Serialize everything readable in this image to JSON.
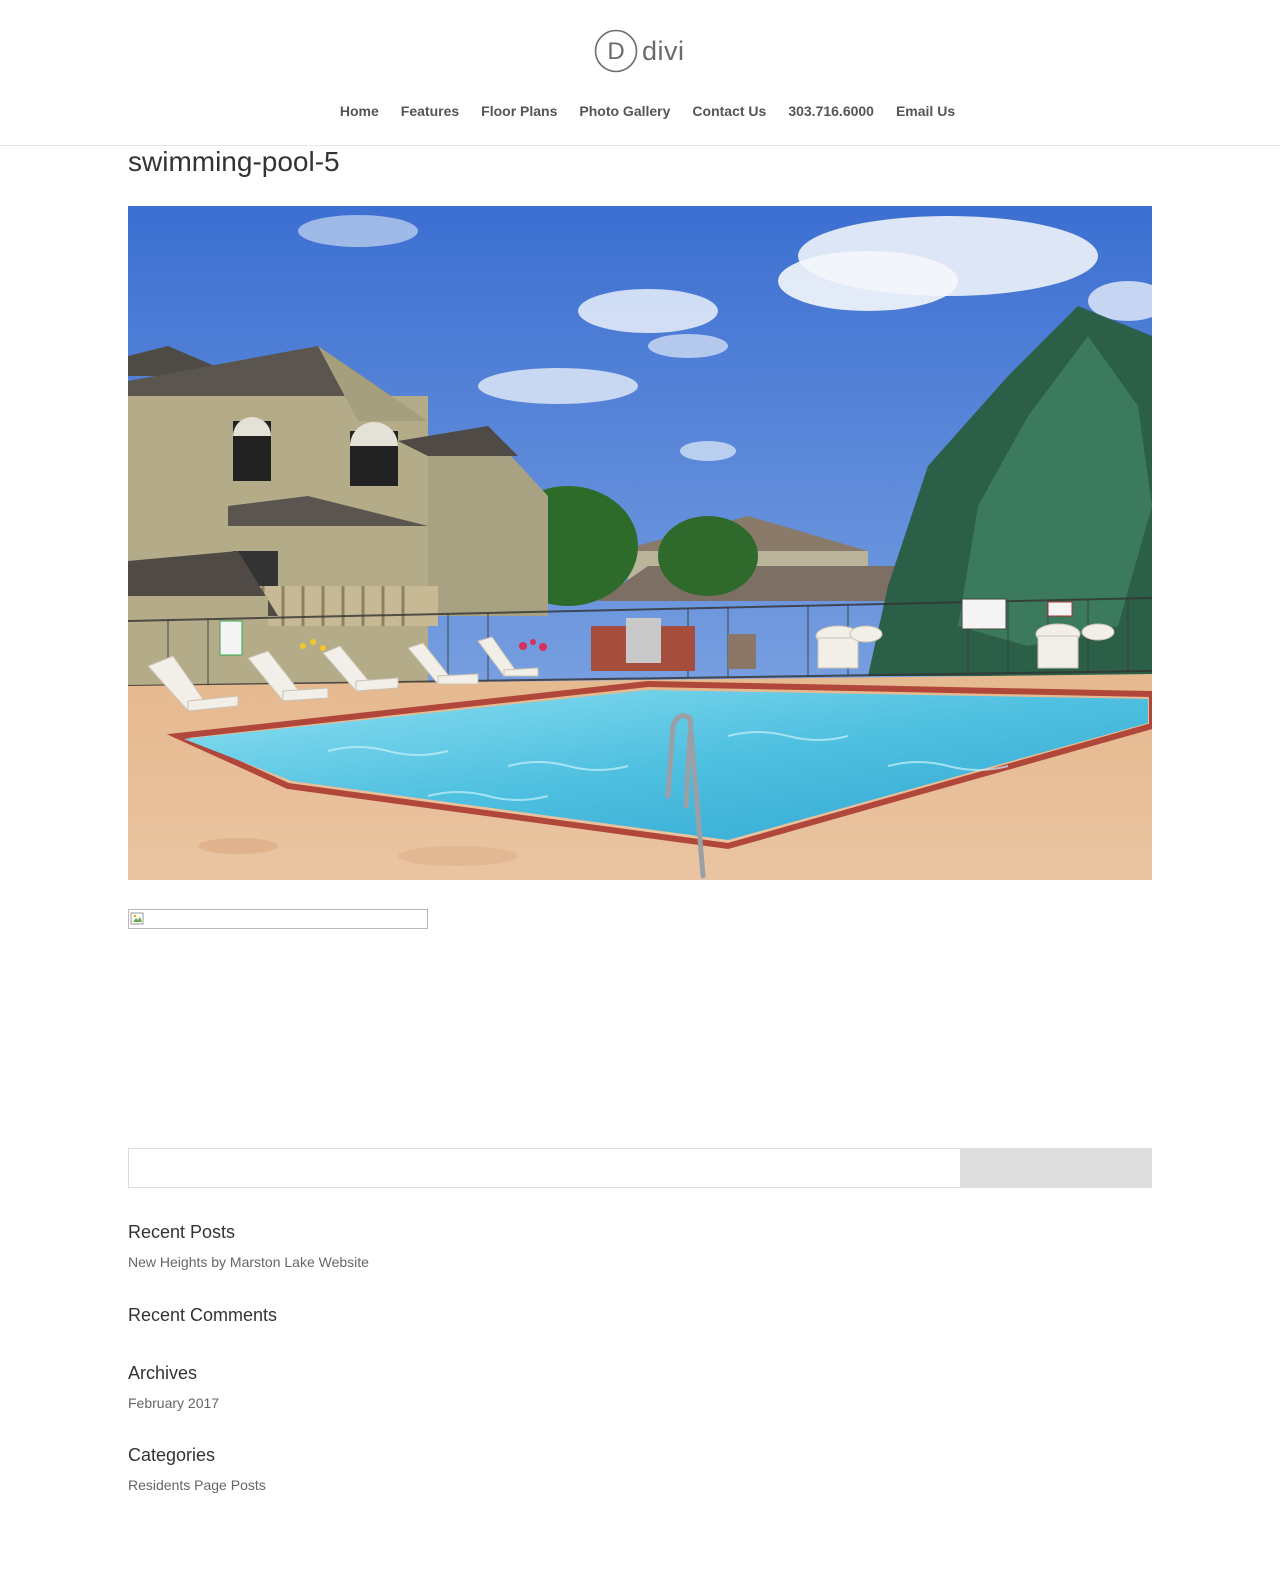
{
  "brand": {
    "logo_letter": "D",
    "name": "divi"
  },
  "nav": {
    "items": [
      {
        "label": "Home"
      },
      {
        "label": "Features"
      },
      {
        "label": "Floor Plans"
      },
      {
        "label": "Photo Gallery"
      },
      {
        "label": "Contact Us"
      },
      {
        "label": "303.716.6000"
      },
      {
        "label": "Email Us"
      }
    ]
  },
  "page": {
    "title": "swimming-pool-5"
  },
  "hero_image": {
    "description": "swimming-pool-icon"
  },
  "search": {
    "value": "",
    "button_label": ""
  },
  "widgets": {
    "recent_posts": {
      "title": "Recent Posts",
      "items": [
        "New Heights by Marston Lake Website"
      ]
    },
    "recent_comments": {
      "title": "Recent Comments"
    },
    "archives": {
      "title": "Archives",
      "items": [
        "February 2017"
      ]
    },
    "categories": {
      "title": "Categories",
      "items": [
        "Residents Page Posts"
      ]
    }
  },
  "colors": {
    "nav_text": "#555555",
    "title_text": "#333333",
    "body_text": "#666666",
    "search_button": "#dddddd",
    "sky": "#4f7fd6",
    "pool_water": "#5fc3e0"
  }
}
